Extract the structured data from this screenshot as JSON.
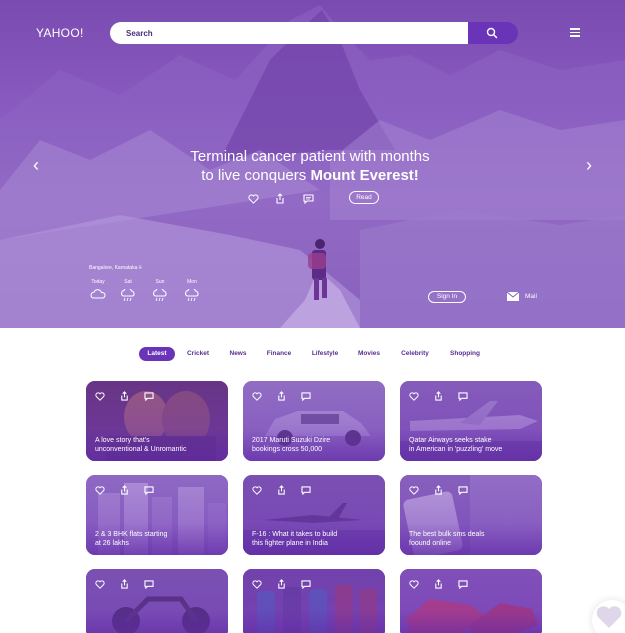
{
  "header": {
    "logo": "YAHOO!",
    "search_placeholder": "Search",
    "search_icon": "search-icon",
    "menu_icon": "hamburger-menu-icon"
  },
  "hero": {
    "headline_line1": "Terminal cancer patient with months",
    "headline_line2_prefix": "to live conquers ",
    "headline_line2_bold": "Mount Everest!",
    "read_label": "Read",
    "prev_icon": "chevron-left-icon",
    "next_icon": "chevron-right-icon",
    "actions": [
      "heart-icon",
      "share-icon",
      "comment-icon"
    ],
    "location": "Bangalore, Karnataka",
    "weather": [
      {
        "day": "Today",
        "icon": "cloud-icon"
      },
      {
        "day": "Sat",
        "icon": "rain-cloud-icon"
      },
      {
        "day": "Sun",
        "icon": "rain-cloud-icon"
      },
      {
        "day": "Mon",
        "icon": "rain-cloud-icon"
      }
    ],
    "signin_label": "Sign In",
    "mail_label": "Mail"
  },
  "tabs": [
    "Latest",
    "Cricket",
    "News",
    "Finance",
    "Lifestyle",
    "Movies",
    "Celebrity",
    "Shopping"
  ],
  "active_tab": "Latest",
  "cards": [
    {
      "caption_line1": "A love story that's",
      "caption_line2": "unconventional & Unromantic"
    },
    {
      "caption_line1": "2017 Maruti Suzuki Dzire",
      "caption_line2": "bookings cross 50,000"
    },
    {
      "caption_line1": "Qatar Airways seeks stake",
      "caption_line2": "in American in 'puzzling' move"
    },
    {
      "caption_line1": "2 & 3 BHK flats starting",
      "caption_line2": "at 26 lakhs"
    },
    {
      "caption_line1": "F-16 : What it takes to build",
      "caption_line2": "this fighter plane in India"
    },
    {
      "caption_line1": "The best bulk sms deals",
      "caption_line2": "foound online"
    },
    {
      "caption_line1": "",
      "caption_line2": ""
    },
    {
      "caption_line1": "",
      "caption_line2": ""
    },
    {
      "caption_line1": "",
      "caption_line2": ""
    }
  ],
  "card_actions": [
    "heart-icon",
    "share-icon",
    "comment-icon"
  ],
  "floating_button_icon": "heart-icon",
  "colors": {
    "brand": "#6a34b8",
    "tab_text": "#5a2d91",
    "hero_tint": "#7a4bb0"
  }
}
